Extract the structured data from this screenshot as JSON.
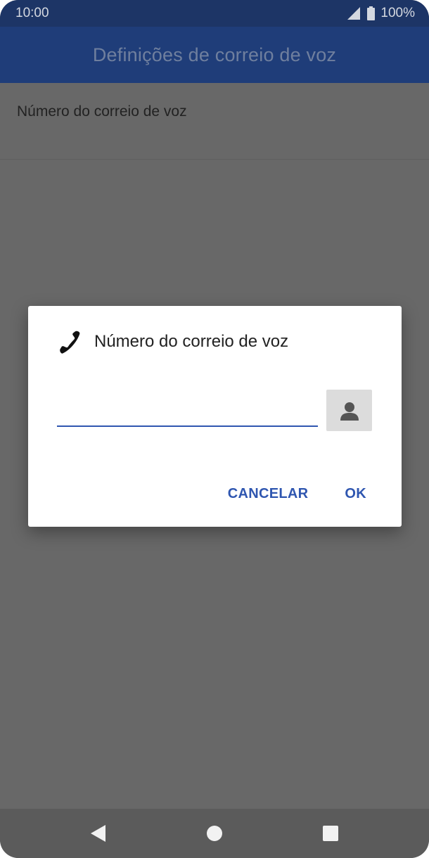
{
  "status_bar": {
    "time": "10:00",
    "battery": "100%",
    "icons": [
      "signal-icon",
      "battery-icon"
    ]
  },
  "app_bar": {
    "title": "Definições de correio de voz"
  },
  "list": {
    "items": [
      {
        "label": "Número do correio de voz"
      }
    ]
  },
  "dialog": {
    "icon": "phone-icon",
    "title": "Número do correio de voz",
    "input": {
      "value": "",
      "placeholder": ""
    },
    "contact_icon": "contact-icon",
    "cancel_label": "CANCELAR",
    "ok_label": "OK"
  },
  "nav_bar": {
    "icons": [
      "back-icon",
      "home-icon",
      "recents-icon"
    ]
  },
  "colors": {
    "status_bar": "#1d3566",
    "app_bar": "#1f3d79",
    "accent": "#2f56b0",
    "scrim": "#686868"
  }
}
